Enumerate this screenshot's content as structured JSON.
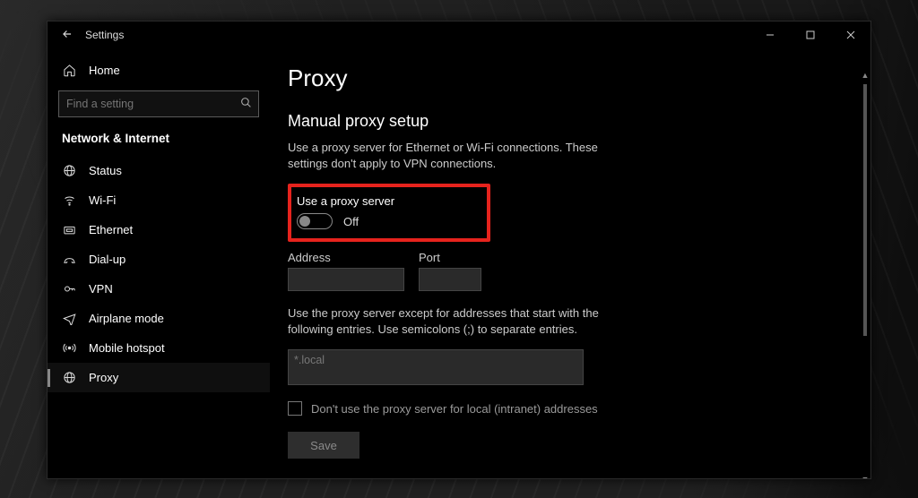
{
  "window": {
    "app_title": "Settings"
  },
  "sidebar": {
    "home_label": "Home",
    "search_placeholder": "Find a setting",
    "section_title": "Network & Internet",
    "items": [
      {
        "label": "Status",
        "icon": "status-icon"
      },
      {
        "label": "Wi-Fi",
        "icon": "wifi-icon"
      },
      {
        "label": "Ethernet",
        "icon": "ethernet-icon"
      },
      {
        "label": "Dial-up",
        "icon": "dialup-icon"
      },
      {
        "label": "VPN",
        "icon": "vpn-icon"
      },
      {
        "label": "Airplane mode",
        "icon": "airplane-icon"
      },
      {
        "label": "Mobile hotspot",
        "icon": "hotspot-icon"
      },
      {
        "label": "Proxy",
        "icon": "proxy-icon"
      }
    ],
    "active_index": 7
  },
  "page": {
    "title": "Proxy",
    "section_title": "Manual proxy setup",
    "section_desc": "Use a proxy server for Ethernet or Wi-Fi connections. These settings don't apply to VPN connections.",
    "toggle_label": "Use a proxy server",
    "toggle_state": "Off",
    "toggle_on": false,
    "address_label": "Address",
    "address_value": "",
    "port_label": "Port",
    "port_value": "",
    "except_desc": "Use the proxy server except for addresses that start with the following entries. Use semicolons (;) to separate entries.",
    "except_value": "*.local",
    "local_cb_label": "Don't use the proxy server for local (intranet) addresses",
    "local_cb_checked": false,
    "save_label": "Save"
  }
}
